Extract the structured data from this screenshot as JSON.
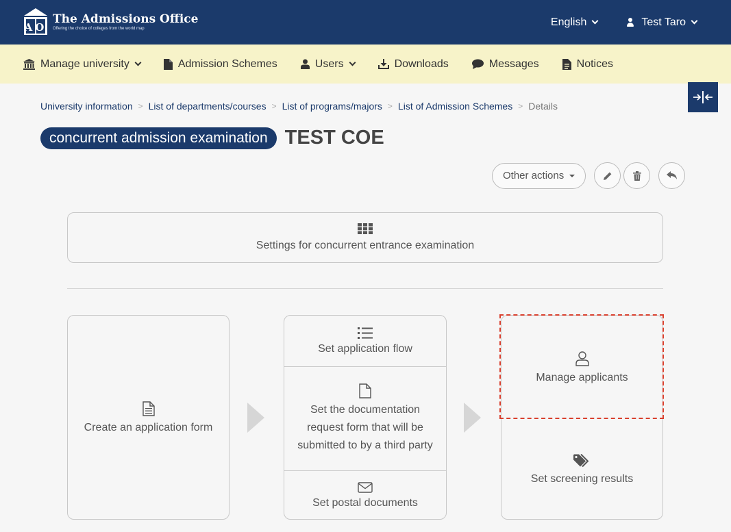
{
  "brand": {
    "title": "The Admissions Office",
    "tagline": "Offering the choice of colleges from the world map",
    "mark_letters": "AO"
  },
  "topbar": {
    "language": "English",
    "user": "Test Taro"
  },
  "nav": {
    "items": [
      {
        "label": "Manage university",
        "icon": "bank-icon",
        "dropdown": true
      },
      {
        "label": "Admission Schemes",
        "icon": "file-icon",
        "dropdown": false
      },
      {
        "label": "Users",
        "icon": "user-icon",
        "dropdown": true
      },
      {
        "label": "Downloads",
        "icon": "download-icon",
        "dropdown": false
      },
      {
        "label": "Messages",
        "icon": "comment-icon",
        "dropdown": false
      },
      {
        "label": "Notices",
        "icon": "document-icon",
        "dropdown": false
      }
    ]
  },
  "breadcrumb": [
    {
      "label": "University information",
      "link": true
    },
    {
      "label": "List of departments/courses",
      "link": true
    },
    {
      "label": "List of programs/majors",
      "link": true
    },
    {
      "label": "List of Admission Schemes",
      "link": true
    },
    {
      "label": "Details",
      "link": false
    }
  ],
  "breadcrumb_separator": ">",
  "header": {
    "badge": "concurrent admission examination",
    "title": "TEST COE"
  },
  "actions": {
    "other_actions": "Other actions",
    "icons": [
      "pencil-icon",
      "trash-icon",
      "reply-icon"
    ]
  },
  "settings_card": {
    "label": "Settings for concurrent entrance examination",
    "icon": "grid-icon"
  },
  "flow": {
    "create_form": "Create an application form",
    "set_flow": "Set application flow",
    "doc_request": "Set the documentation request form that will be submitted to by a third party",
    "postal_docs": "Set postal documents",
    "manage_applicants": "Manage applicants",
    "screening_results": "Set screening results"
  },
  "colors": {
    "primary": "#1b3a6b",
    "nav_bg": "#f7f3c9",
    "page_bg": "#f6f6f6",
    "highlight": "#d9402e"
  }
}
